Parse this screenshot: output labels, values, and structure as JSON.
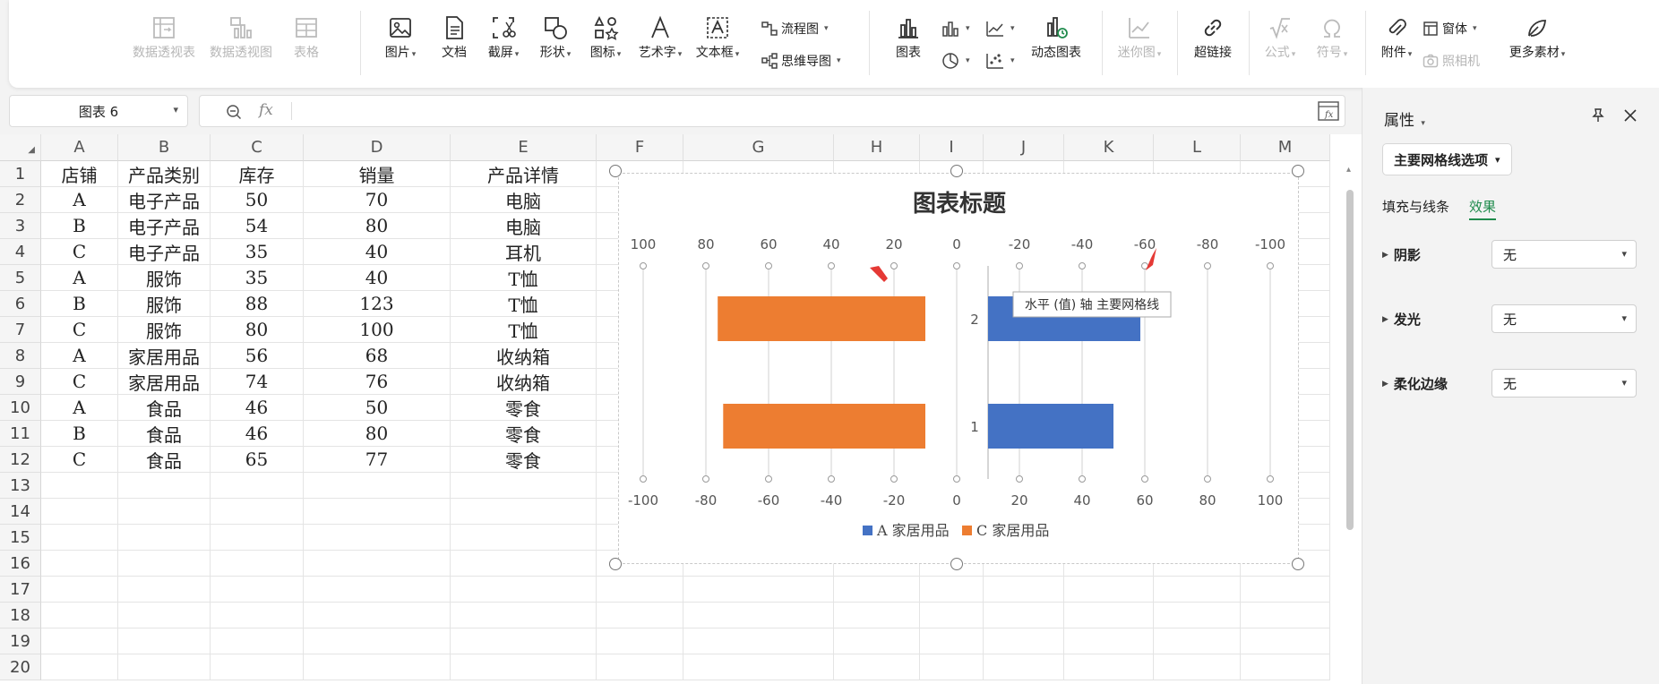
{
  "toolbar": {
    "group1": [
      {
        "label": "数据透视表",
        "icon": "pivot-table-icon",
        "disabled": true
      },
      {
        "label": "数据透视图",
        "icon": "pivot-chart-icon",
        "disabled": true
      },
      {
        "label": "表格",
        "icon": "table-icon",
        "disabled": true
      }
    ],
    "group2": [
      {
        "label": "图片",
        "icon": "picture-icon",
        "caret": true
      },
      {
        "label": "文档",
        "icon": "document-icon"
      },
      {
        "label": "截屏",
        "icon": "screenshot-icon",
        "caret": true
      },
      {
        "label": "形状",
        "icon": "shapes-icon",
        "caret": true
      },
      {
        "label": "图标",
        "icon": "icons-icon",
        "caret": true
      },
      {
        "label": "艺术字",
        "icon": "wordart-icon",
        "caret": true
      },
      {
        "label": "文本框",
        "icon": "textbox-icon",
        "caret": true
      }
    ],
    "flowchart": "流程图",
    "mindmap": "思维导图",
    "group3_chart": "图表",
    "dynamic_chart": "动态图表",
    "sparkline": "迷你图",
    "hyperlink": "超链接",
    "formula": "公式",
    "symbol": "符号",
    "attachment": "附件",
    "window": "窗体",
    "camera": "照相机",
    "more_material": "更多素材"
  },
  "namebox": {
    "value": "图表 6"
  },
  "formula_bar": {
    "fx": "fx",
    "value": ""
  },
  "sheet": {
    "columns": [
      "A",
      "B",
      "C",
      "D",
      "E",
      "F",
      "G",
      "H",
      "I",
      "J",
      "K",
      "L",
      "M"
    ],
    "rows": [
      [
        "店铺",
        "产品类别",
        "库存",
        "销量",
        "产品详情"
      ],
      [
        "A",
        "电子产品",
        "50",
        "70",
        "电脑"
      ],
      [
        "B",
        "电子产品",
        "54",
        "80",
        "电脑"
      ],
      [
        "C",
        "电子产品",
        "35",
        "40",
        "耳机"
      ],
      [
        "A",
        "服饰",
        "35",
        "40",
        "T恤"
      ],
      [
        "B",
        "服饰",
        "88",
        "123",
        "T恤"
      ],
      [
        "C",
        "服饰",
        "80",
        "100",
        "T恤"
      ],
      [
        "A",
        "家居用品",
        "56",
        "68",
        "收纳箱"
      ],
      [
        "C",
        "家居用品",
        "74",
        "76",
        "收纳箱"
      ],
      [
        "A",
        "食品",
        "46",
        "50",
        "零食"
      ],
      [
        "B",
        "食品",
        "46",
        "80",
        "零食"
      ],
      [
        "C",
        "食品",
        "65",
        "77",
        "零食"
      ]
    ],
    "row_numbers": [
      "1",
      "2",
      "3",
      "4",
      "5",
      "6",
      "7",
      "8",
      "9",
      "10",
      "11",
      "12",
      "13",
      "14",
      "15",
      "16",
      "17",
      "18",
      "19",
      "20"
    ]
  },
  "chart_data": {
    "type": "bar",
    "title": "图表标题",
    "categories": [
      "1",
      "2"
    ],
    "series": [
      {
        "name": "A 家居用品",
        "color": "#4472c4",
        "values": [
          56,
          68
        ]
      },
      {
        "name": "C 家居用品",
        "color": "#ed7d31",
        "values": [
          74,
          76
        ]
      }
    ],
    "top_axis_ticks": [
      "100",
      "80",
      "60",
      "40",
      "20",
      "0",
      "-20",
      "-40",
      "-60",
      "-80",
      "-100"
    ],
    "bottom_axis_ticks": [
      "-100",
      "-80",
      "-60",
      "-40",
      "-20",
      "0",
      "20",
      "40",
      "60",
      "80",
      "100"
    ],
    "xlim": [
      -100,
      100
    ],
    "legend_position": "bottom",
    "grid": true,
    "tooltip": "水平 (值) 轴 主要网格线"
  },
  "panel": {
    "title": "属性",
    "dropdown": "主要网格线选项",
    "tabs": [
      "填充与线条",
      "效果"
    ],
    "active_tab": "效果",
    "rows": [
      {
        "label": "阴影",
        "value": "无"
      },
      {
        "label": "发光",
        "value": "无"
      },
      {
        "label": "柔化边缘",
        "value": "无"
      }
    ]
  },
  "colors": {
    "accent": "#1f8b4c",
    "arrow": "#e53935"
  }
}
